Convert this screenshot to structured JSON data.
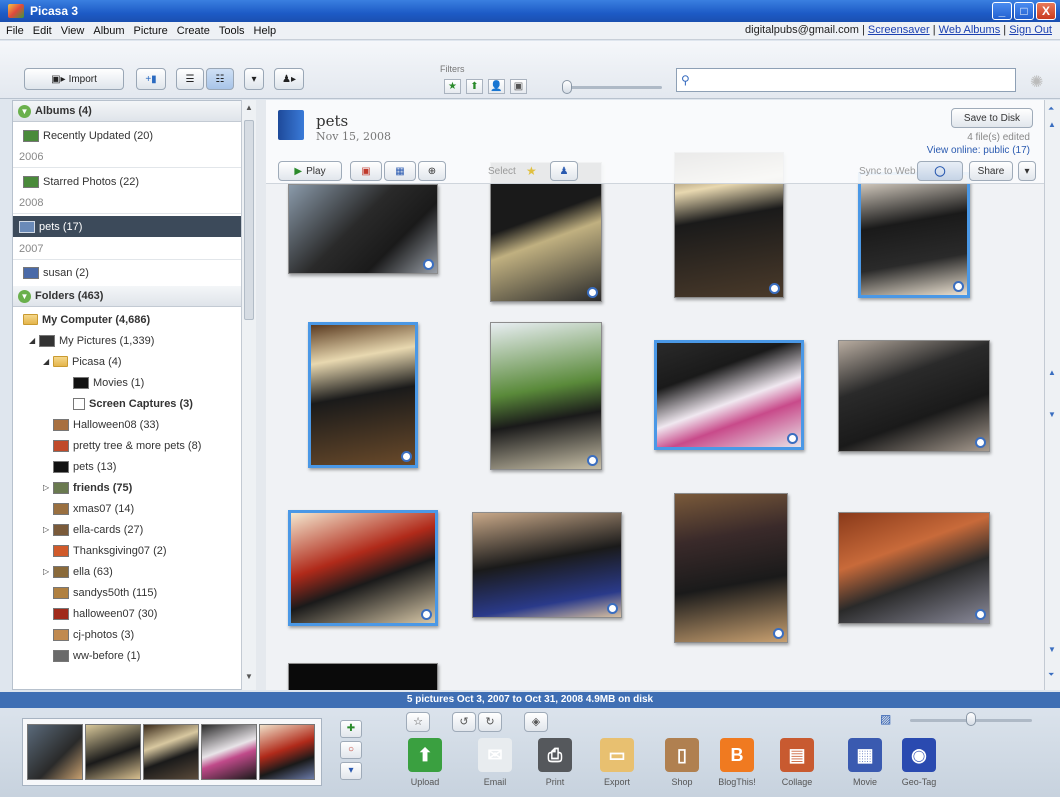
{
  "window": {
    "title": "Picasa 3",
    "minimize": "_",
    "maximize": "□",
    "close": "X"
  },
  "menu": [
    "File",
    "Edit",
    "View",
    "Album",
    "Picture",
    "Create",
    "Tools",
    "Help"
  ],
  "account": {
    "email": "digitalpubs@gmail.com",
    "sep": "|",
    "links": [
      "Screensaver",
      "Web Albums",
      "Sign Out"
    ]
  },
  "toolbar": {
    "import_label": "Import",
    "filters_label": "Filters",
    "filter_icons": [
      "★",
      "⬆",
      "👤",
      "▣"
    ],
    "search_placeholder": ""
  },
  "left_panel": {
    "albums_header": "Albums (4)",
    "recently_updated": "Recently Updated (20)",
    "year_2006": "2006",
    "starred": "Starred Photos (22)",
    "year_2008": "2008",
    "pets": "pets (17)",
    "year_2007": "2007",
    "susan": "susan (2)",
    "folders_header": "Folders (463)",
    "my_computer": "My Computer (4,686)",
    "my_pictures": "My Pictures (1,339)",
    "picasa": "Picasa (4)",
    "movies": "Movies (1)",
    "screen_captures": "Screen Captures (3)",
    "folders": [
      {
        "label": "Halloween08 (33)",
        "color": "#a87040"
      },
      {
        "label": "pretty tree & more pets (8)",
        "color": "#c04a2a"
      },
      {
        "label": "pets (13)",
        "color": "#111111"
      },
      {
        "label": "friends (75)",
        "color": "#6a7a50"
      },
      {
        "label": "xmas07 (14)",
        "color": "#9a7040"
      },
      {
        "label": "ella-cards (27)",
        "color": "#7a5a3a"
      },
      {
        "label": "Thanksgiving07 (2)",
        "color": "#d05a2a"
      },
      {
        "label": "ella (63)",
        "color": "#8a6a3a"
      },
      {
        "label": "sandys50th (115)",
        "color": "#b08040"
      },
      {
        "label": "halloween07 (30)",
        "color": "#a02a1a"
      },
      {
        "label": "cj-photos (3)",
        "color": "#c08a50"
      },
      {
        "label": "ww-before (1)",
        "color": "#6a6a6a"
      }
    ]
  },
  "album": {
    "title": "pets",
    "date": "Nov 15, 2008",
    "save_label": "Save to Disk",
    "files_edited": "4 file(s) edited",
    "view_online": "View online: public (17)",
    "play_label": "Play",
    "select_label": "Select",
    "sync_label": "Sync to Web",
    "share_label": "Share"
  },
  "status": "5 pictures    Oct 3, 2007 to Oct 31, 2008    4.9MB on disk",
  "tray": {
    "actions": [
      {
        "label": "Upload",
        "color": "#3aa040"
      },
      {
        "label": "Email",
        "color": "#e8ecef"
      },
      {
        "label": "Print",
        "color": "#55585c"
      },
      {
        "label": "Export",
        "color": "#e8c070"
      },
      {
        "label": "Shop",
        "color": "#b08050"
      },
      {
        "label": "BlogThis!",
        "color": "#f07a20"
      },
      {
        "label": "Collage",
        "color": "#c85a30"
      },
      {
        "label": "Movie",
        "color": "#3a5ab0"
      },
      {
        "label": "Geo-Tag",
        "color": "#2a4ab0"
      }
    ]
  }
}
